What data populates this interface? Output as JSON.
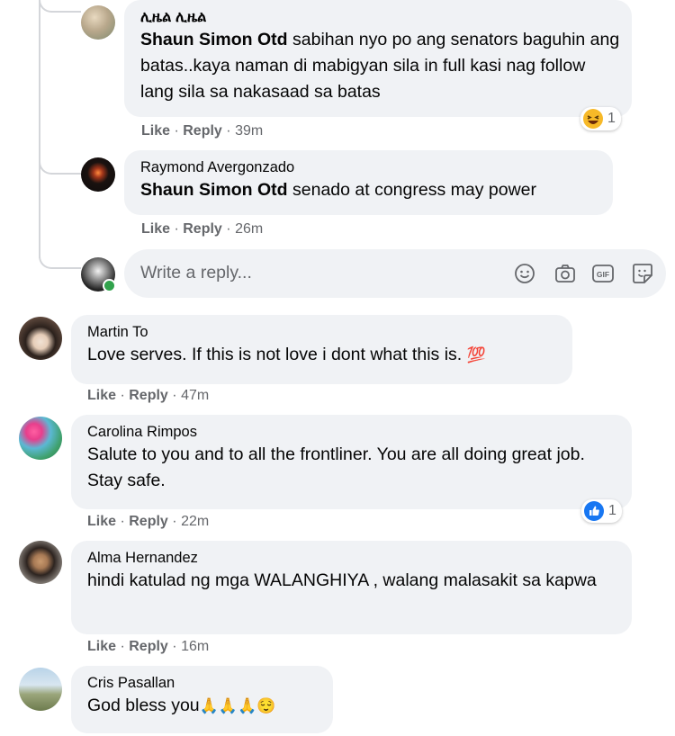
{
  "comments": [
    {
      "author": "ሊዜል ሊዜል",
      "mention": "Shaun Simon Otd",
      "text": " sabihan nyo po ang senators baguhin ang batas..kaya naman di mabigyan sila in full kasi nag follow lang sila sa nakasaad sa batas",
      "like": "Like",
      "reply": "Reply",
      "time": "39m",
      "reaction": {
        "icon": "haha-icon",
        "count": "1"
      }
    },
    {
      "author": "Raymond Avergonzado",
      "mention": "Shaun Simon Otd",
      "text": " senado at congress may power",
      "like": "Like",
      "reply": "Reply",
      "time": "26m"
    },
    {
      "author": "Martin To",
      "text": "Love serves. If this is not love i dont what this is.",
      "emoji": "💯",
      "like": "Like",
      "reply": "Reply",
      "time": "47m"
    },
    {
      "author": "Carolina Rimpos",
      "text": "Salute to you and to all the frontliner. You are all doing great job. Stay safe.",
      "like": "Like",
      "reply": "Reply",
      "time": "22m",
      "reaction": {
        "icon": "like-icon",
        "count": "1"
      }
    },
    {
      "author": "Alma Hernandez",
      "text": "hindi katulad ng mga WALANGHIYA , walang malasakit sa kapwa",
      "like": "Like",
      "reply": "Reply",
      "time": "16m"
    },
    {
      "author": "Cris Pasallan",
      "text": "God bless you",
      "emoji": "🙏🙏🙏😌"
    }
  ],
  "reply_box": {
    "placeholder": "Write a reply...",
    "icons": [
      "emoji-icon",
      "camera-icon",
      "gif-icon",
      "sticker-icon"
    ]
  },
  "separator": "·",
  "colors": {
    "bubble": "#f0f2f5",
    "meta": "#65676b",
    "like_blue": "#1877f2",
    "haha_yellow": "#f7b928",
    "online_green": "#31a24c"
  }
}
